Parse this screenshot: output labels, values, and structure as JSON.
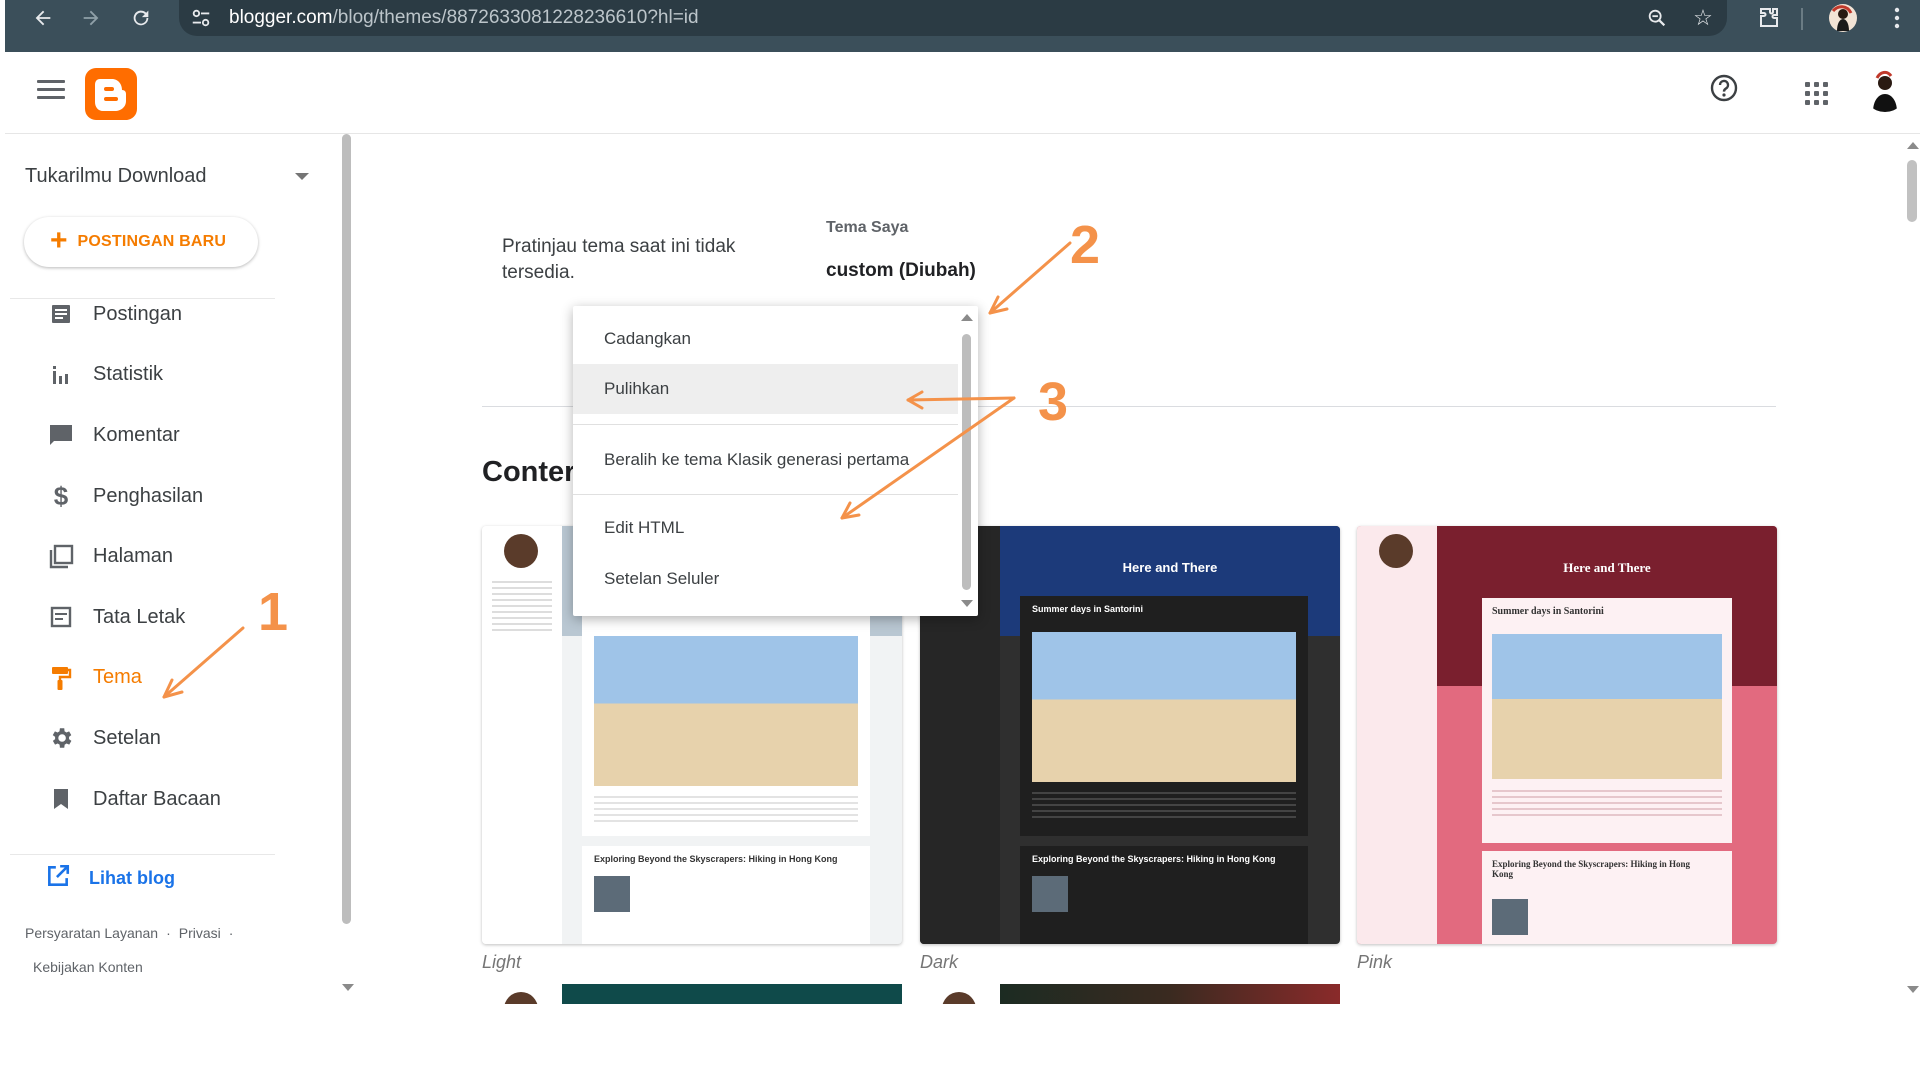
{
  "browser": {
    "url_host": "blogger.com",
    "url_path": "/blog/themes/8872633081228236610?hl=id"
  },
  "colors": {
    "accent": "#f57c00",
    "link": "#1a73e8",
    "annotation": "#f4924a",
    "chrome": "#3b4f5a"
  },
  "icons": {
    "back": "arrow-left-icon",
    "forward": "arrow-right-icon",
    "reload": "reload-icon",
    "site_settings": "tune-icon",
    "zoom": "zoom-icon",
    "bookmark": "star-icon",
    "extensions": "puzzle-icon",
    "menu": "kebab-icon"
  },
  "sidebar": {
    "blog_name": "Tukarilmu Download",
    "new_post_label": "POSTINGAN BARU",
    "items": [
      {
        "label": "Postingan",
        "icon": "posts-icon"
      },
      {
        "label": "Statistik",
        "icon": "stats-icon"
      },
      {
        "label": "Komentar",
        "icon": "comment-icon"
      },
      {
        "label": "Penghasilan",
        "icon": "dollar-icon"
      },
      {
        "label": "Halaman",
        "icon": "pages-icon"
      },
      {
        "label": "Tata Letak",
        "icon": "layout-icon"
      },
      {
        "label": "Tema",
        "icon": "paint-roller-icon",
        "active": true
      },
      {
        "label": "Setelan",
        "icon": "gear-icon"
      },
      {
        "label": "Daftar Bacaan",
        "icon": "bookmark-icon"
      }
    ],
    "view_blog_label": "Lihat blog",
    "footer": {
      "terms": "Persyaratan Layanan",
      "privacy": "Privasi",
      "content_policy": "Kebijakan Konten",
      "separator": "·"
    }
  },
  "main": {
    "preview_message": "Pratinjau tema saat ini tidak tersedia.",
    "my_theme_heading": "Tema Saya",
    "theme_name": "custom (Diubah)",
    "section_title": "Conter",
    "cards": [
      {
        "label": "Light",
        "banner_title": "",
        "post_title": "",
        "post2_title": "Exploring Beyond the Skyscrapers: Hiking in Hong Kong"
      },
      {
        "label": "Dark",
        "banner_title": "Here and There",
        "post_title": "Summer days in Santorini",
        "post2_title": "Exploring Beyond the Skyscrapers: Hiking in Hong Kong"
      },
      {
        "label": "Pink",
        "banner_title": "Here and There",
        "post_title": "Summer days in Santorini",
        "post2_title": "Exploring Beyond the Skyscrapers: Hiking in Hong Kong"
      }
    ]
  },
  "menu": {
    "items": [
      "Cadangkan",
      "Pulihkan",
      "Beralih ke tema Klasik generasi pertama",
      "Edit HTML",
      "Setelan Seluler"
    ],
    "highlighted": "Pulihkan"
  },
  "annotations": [
    "1",
    "2",
    "3"
  ]
}
